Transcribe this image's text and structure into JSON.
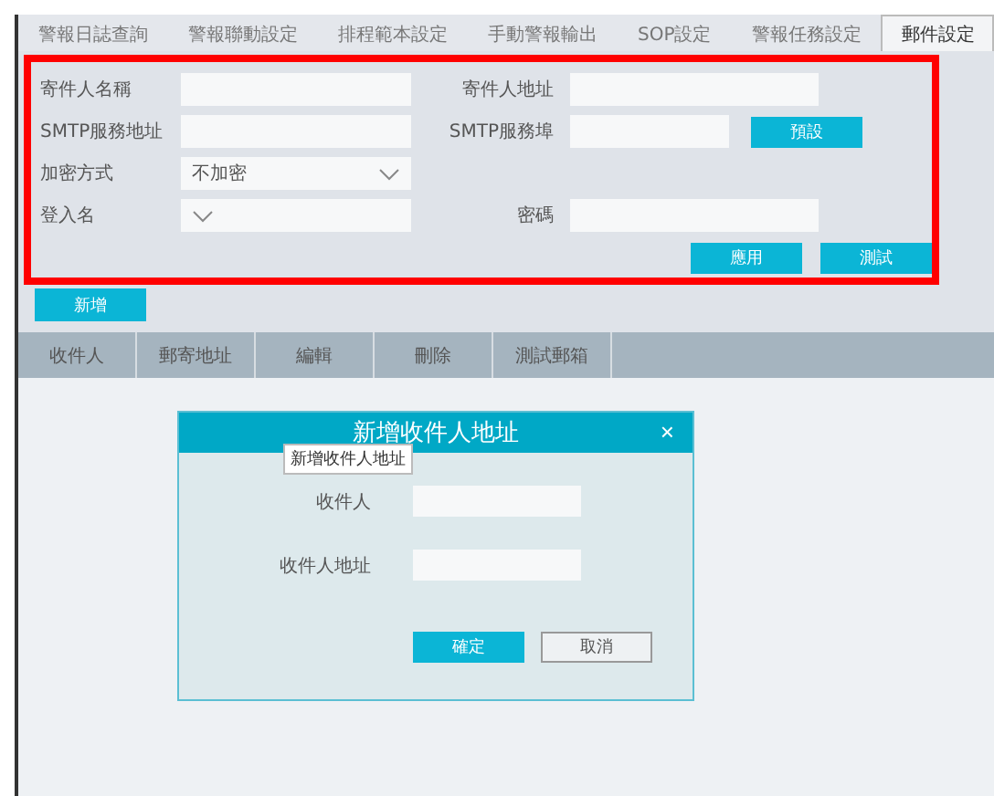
{
  "tabs": [
    {
      "label": "警報日誌查詢",
      "selected": false
    },
    {
      "label": "警報聯動設定",
      "selected": false
    },
    {
      "label": "排程範本設定",
      "selected": false
    },
    {
      "label": "手動警報輸出",
      "selected": false
    },
    {
      "label": "SOP設定",
      "selected": false
    },
    {
      "label": "警報任務設定",
      "selected": false
    },
    {
      "label": "郵件設定",
      "selected": true
    }
  ],
  "form_rows": [
    [
      {
        "kind": "input",
        "label": "寄件人名稱"
      },
      {
        "kind": "input",
        "label": "寄件人地址"
      }
    ],
    [
      {
        "kind": "input",
        "label": "SMTP服務地址"
      },
      {
        "kind": "short-input",
        "label": "SMTP服務埠"
      },
      {
        "kind": "button",
        "label": "預設"
      }
    ],
    [
      {
        "kind": "select",
        "label": "加密方式",
        "value": "不加密"
      }
    ],
    [
      {
        "kind": "select",
        "label": "登入名"
      },
      {
        "kind": "input",
        "label": "密碼"
      }
    ],
    [
      {
        "kind": "button",
        "label": "應用"
      },
      {
        "kind": "button",
        "label": "測試"
      }
    ]
  ],
  "add_button": "新增",
  "table": {
    "columns": [
      "收件人",
      "郵寄地址",
      "編輯",
      "刪除",
      "測試郵箱"
    ]
  },
  "dialog": {
    "title": "新增收件人地址",
    "close": "×",
    "tooltip": "新增收件人地址",
    "fields": [
      {
        "label": "收件人"
      },
      {
        "label": "收件人地址"
      }
    ],
    "buttons": [
      {
        "label": "確定",
        "kind": "primary"
      },
      {
        "label": "取消",
        "kind": "secondary"
      }
    ]
  }
}
